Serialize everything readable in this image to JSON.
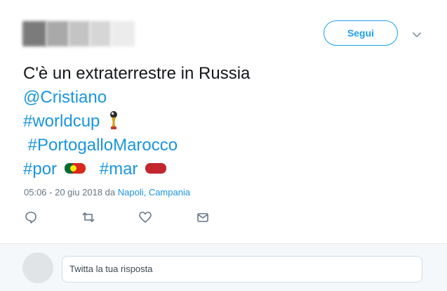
{
  "header": {
    "follow_label": "Segui"
  },
  "tweet": {
    "line1": "C'è un extraterrestre in Russia",
    "mention": "@Cristiano",
    "hashtag_worldcup": "#worldcup",
    "hashtag_portogallo": "#PortogalloMarocco",
    "hashtag_por": "#por",
    "hashtag_mar": "#mar"
  },
  "meta": {
    "timestamp": "05:06 - 20 giu 2018 da ",
    "place": "Napoli, Campania"
  },
  "actions": [
    "reply-icon",
    "retweet-icon",
    "like-icon",
    "message-icon"
  ],
  "reply": {
    "placeholder": "Twitta la tua risposta"
  },
  "colors": {
    "accent": "#1da1f2",
    "link": "#1b95e0",
    "text": "#14171a",
    "muted": "#657786"
  }
}
